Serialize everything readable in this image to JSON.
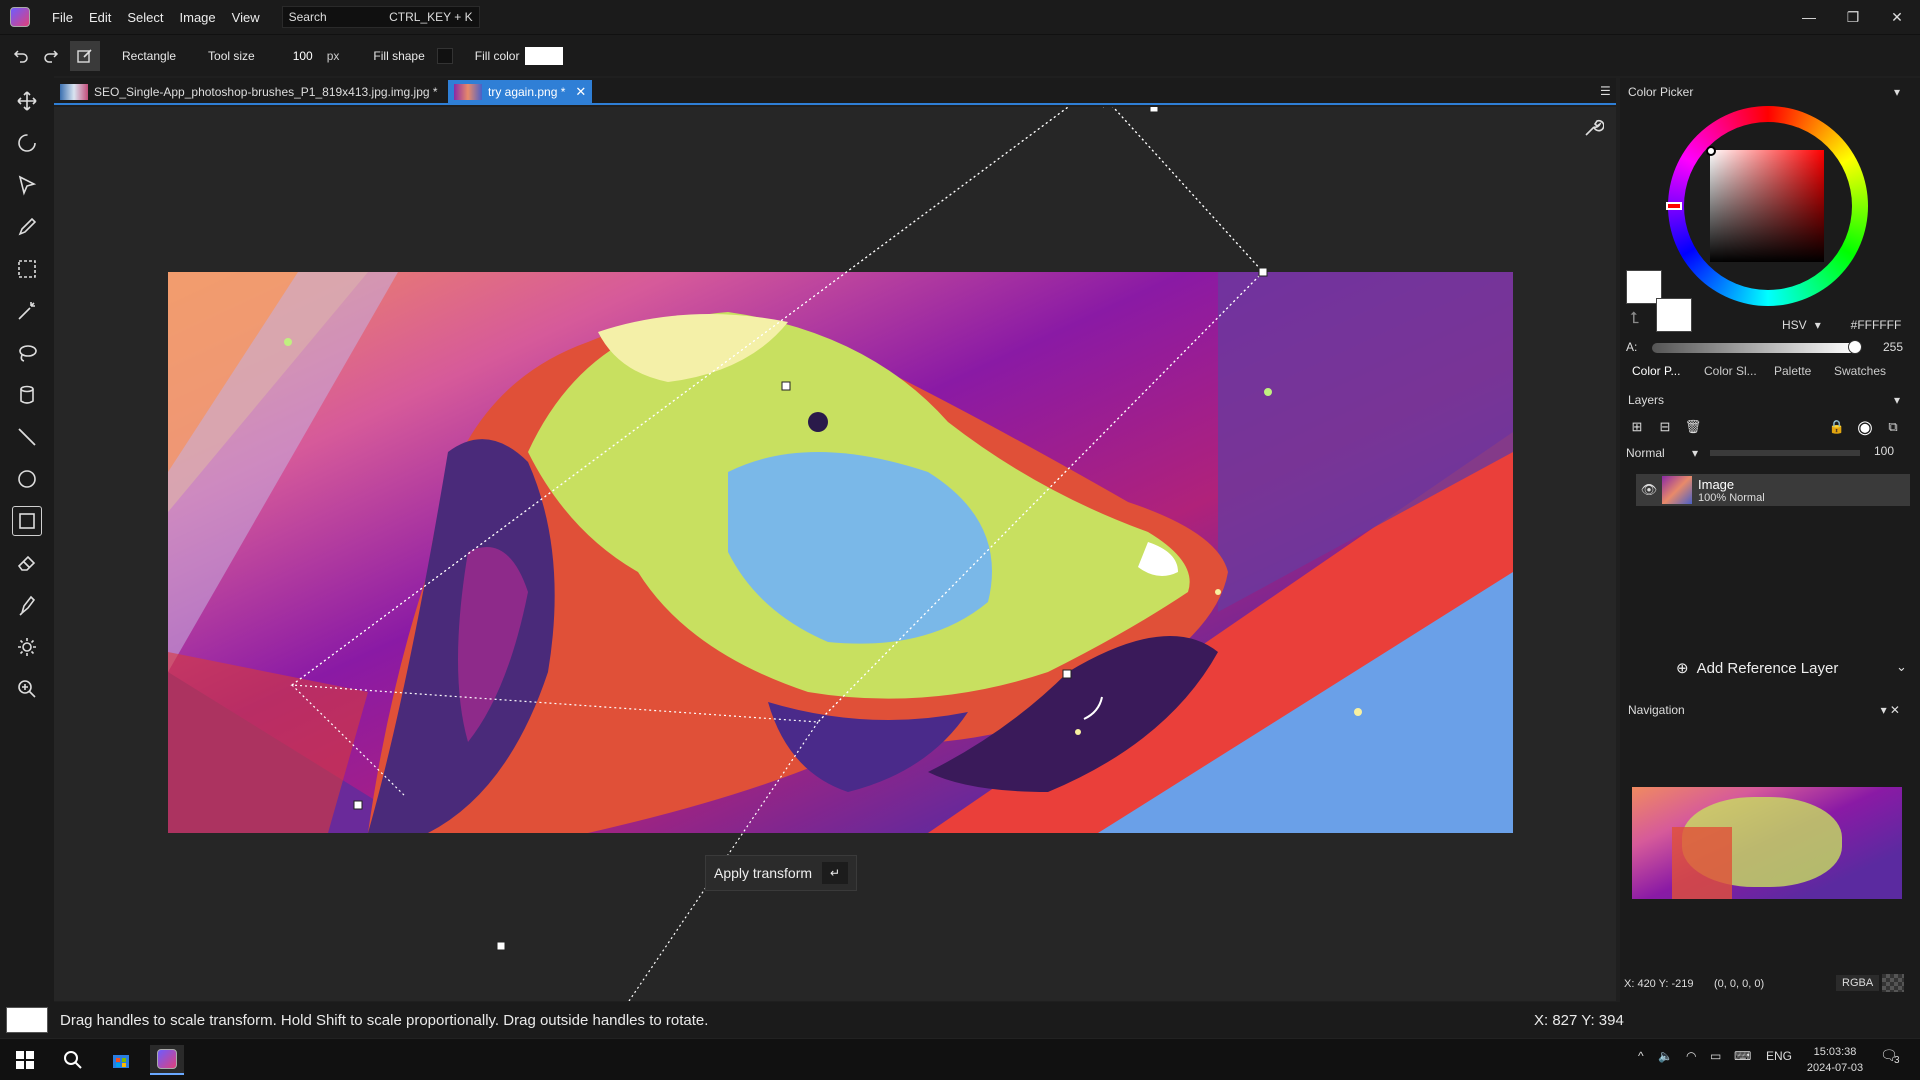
{
  "menubar": {
    "items": [
      "File",
      "Edit",
      "Select",
      "Image",
      "View"
    ],
    "search_label": "Search",
    "search_shortcut": "CTRL_KEY + K",
    "window_controls": [
      "minimize-icon",
      "restore-icon",
      "close-icon"
    ]
  },
  "options": {
    "tool_name": "Rectangle",
    "tool_size_label": "Tool size",
    "tool_size_value": "100",
    "tool_size_unit": "px",
    "fill_shape_label": "Fill shape",
    "fill_color_label": "Fill color",
    "fill_color": "#FFFFFF"
  },
  "toolbar": {
    "tools": [
      "move-icon",
      "rotate-icon",
      "pointer-icon",
      "pencil-icon",
      "rect-select-icon",
      "magic-wand-icon",
      "lasso-icon",
      "bucket-icon",
      "line-icon",
      "ellipse-icon",
      "rectangle-icon",
      "eraser-icon",
      "pen-icon",
      "brightness-icon",
      "zoom-icon"
    ],
    "active_tool": "rectangle-icon"
  },
  "tabs": [
    {
      "label": "SEO_Single-App_photoshop-brushes_P1_819x413.jpg.img.jpg *",
      "active": false
    },
    {
      "label": "try again.png *",
      "active": true
    }
  ],
  "canvas": {
    "apply_transform_label": "Apply transform",
    "apply_transform_key": "↵"
  },
  "color_picker": {
    "title": "Color Picker",
    "mode": "HSV",
    "hex": "#FFFFFF",
    "alpha_label": "A:",
    "alpha_value": "255",
    "primary_color": "#FFFFFF",
    "secondary_color": "#FFFFFF",
    "tabs": [
      "Color P...",
      "Color Sl...",
      "Palette",
      "Swatches"
    ]
  },
  "layers": {
    "title": "Layers",
    "blend_mode": "Normal",
    "opacity": "100",
    "items": [
      {
        "name": "Image",
        "detail": "100% Normal"
      }
    ],
    "add_reference_label": "Add Reference Layer"
  },
  "navigation": {
    "title": "Navigation",
    "coords": "X: 420 Y: -219",
    "rgba_values": "(0, 0, 0, 0)",
    "mode_label": "RGBA"
  },
  "status": {
    "hint": "Drag handles to scale transform. Hold Shift to scale proportionally. Drag outside handles to rotate.",
    "cursor": "X: 827 Y: 394"
  },
  "taskbar": {
    "language": "ENG",
    "time": "15:03:38",
    "date": "2024-07-03",
    "notification_count": "3"
  }
}
